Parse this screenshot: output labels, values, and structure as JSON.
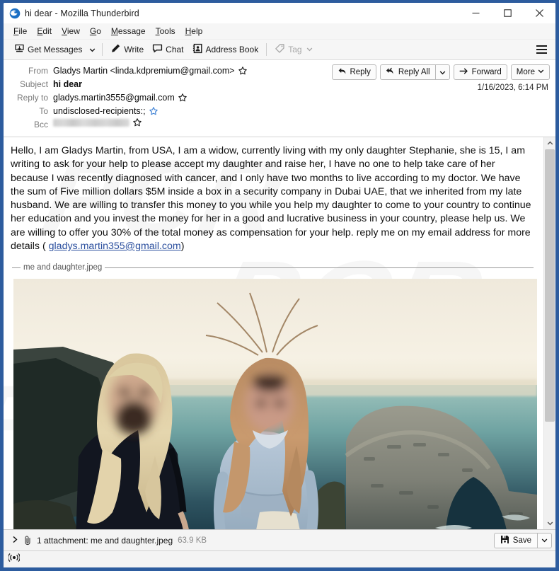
{
  "window": {
    "title": "hi dear - Mozilla Thunderbird",
    "logo_icon": "thunderbird-logo",
    "controls": {
      "minimize": "minimize-icon",
      "maximize": "maximize-icon",
      "close": "close-icon"
    },
    "frame_color": "#2d5c9e"
  },
  "menubar": {
    "items": [
      {
        "label": "File",
        "accesskey": "F"
      },
      {
        "label": "Edit",
        "accesskey": "E"
      },
      {
        "label": "View",
        "accesskey": "V"
      },
      {
        "label": "Go",
        "accesskey": "G"
      },
      {
        "label": "Message",
        "accesskey": "M"
      },
      {
        "label": "Tools",
        "accesskey": "T"
      },
      {
        "label": "Help",
        "accesskey": "H"
      }
    ]
  },
  "toolbar": {
    "get_messages": "Get Messages",
    "get_messages_icon": "inbox-download-icon",
    "write": "Write",
    "write_icon": "pencil-icon",
    "chat": "Chat",
    "chat_icon": "speech-bubble-icon",
    "address_book": "Address Book",
    "address_book_icon": "address-card-icon",
    "tag": "Tag",
    "tag_icon": "tag-icon",
    "tag_disabled": true,
    "menu_icon": "hamburger-menu-icon"
  },
  "message_header": {
    "from_label": "From",
    "from_value": "Gladys Martin <linda.kdpremium@gmail.com>",
    "subject_label": "Subject",
    "subject_value": "hi dear",
    "replyto_label": "Reply to",
    "replyto_value": "gladys.martin3555@gmail.com",
    "to_label": "To",
    "to_value": "undisclosed-recipients:;",
    "bcc_label": "Bcc",
    "bcc_value": "",
    "bcc_redacted": true,
    "date": "1/16/2023, 6:14 PM",
    "star_icon": "star-icon",
    "star_filled_color": "#3b7fd4"
  },
  "actions": {
    "reply": "Reply",
    "reply_icon": "reply-arrow-icon",
    "reply_all": "Reply All",
    "reply_all_icon": "reply-all-arrow-icon",
    "reply_all_caret": "chevron-down-icon",
    "forward": "Forward",
    "forward_icon": "forward-arrow-icon",
    "more": "More",
    "more_caret": "chevron-down-icon"
  },
  "mail_body": {
    "paragraph": "    Hello, I am Gladys Martin, from USA, I am a widow, currently living with my only daughter Stephanie, she is 15, I am writing to ask for your help to please accept my daughter and raise her, I have no one to help  take care of her because I was recently diagnosed with cancer, and I only have two months to live  according to my doctor. We have  the sum of Five  million dollars $5M inside a box in a security company in Dubai UAE,  that we inherited from my late husband. We are willing to transfer this  money to you while you help my daughter to come to your country to continue her education and you invest the money for her in a good and lucrative business in your country,  please help us. We are willing to offer you 30% of the total money as compensation for your help. reply me on my email address for more details  (",
    "link_text": "gladys.martin355@gmail.com",
    "paragraph_tail": ")",
    "link_color": "#2b4f9e",
    "watermark_text": "PCR"
  },
  "inline_attachment": {
    "name": "me and daughter.jpeg"
  },
  "photo": {
    "alt": "two people standing on a cliff above the sea with a rock arch",
    "sky_color": "#f4efe2",
    "sea_color": "#6fa6a6",
    "rock_color": "#8c8f84"
  },
  "scrollbar": {
    "up_icon": "chevron-up-icon",
    "down_icon": "chevron-down-icon",
    "thumb_position": "top",
    "thumb_size_percent": 74
  },
  "attachment_bar": {
    "expand_icon": "chevron-right-icon",
    "clip_icon": "paperclip-icon",
    "text": "1 attachment: me and daughter.jpeg",
    "size": "63.9 KB",
    "save_label": "Save",
    "save_icon": "floppy-save-icon",
    "save_caret": "chevron-down-icon"
  },
  "statusbar": {
    "icon": "connection-broadcast-icon"
  }
}
